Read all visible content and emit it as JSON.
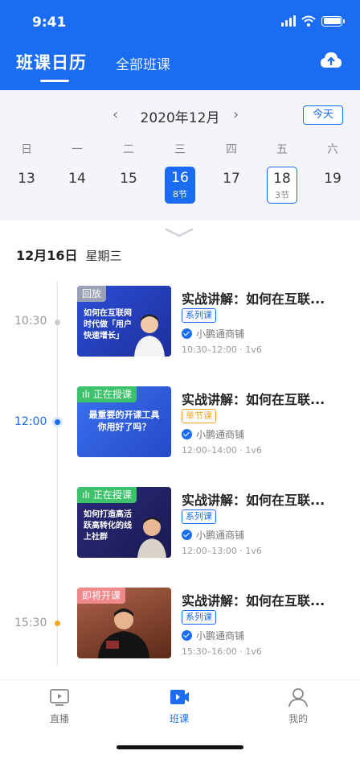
{
  "status_bar": {
    "time": "9:41"
  },
  "header": {
    "tab_active": "班课日历",
    "tab_inactive": "全部班课",
    "upload_icon": "cloud-upload-icon"
  },
  "calendar": {
    "month": "2020年12月",
    "today_label": "今天",
    "weekdays": [
      "日",
      "一",
      "二",
      "三",
      "四",
      "五",
      "六"
    ],
    "dates": [
      {
        "num": "13"
      },
      {
        "num": "14"
      },
      {
        "num": "15"
      },
      {
        "num": "16",
        "sub": "8节",
        "state": "selected"
      },
      {
        "num": "17"
      },
      {
        "num": "18",
        "sub": "3节",
        "state": "marked"
      },
      {
        "num": "19"
      }
    ]
  },
  "day": {
    "date": "12月16日",
    "weekday": "星期三"
  },
  "timeline": [
    {
      "time": "10:30",
      "dot_color": "#c8cbd0",
      "active": false
    },
    {
      "time": "12:00",
      "dot_color": "#1a6cf2",
      "active": true
    },
    {
      "time": "15:30",
      "dot_color": "#f5a623",
      "active": false
    }
  ],
  "courses": [
    {
      "badge": "回放",
      "badge_color": "#9aa3b5",
      "thumb_bg": "#2c4fd8",
      "thumb_text": "如何在互联网时代做「用户快速增长」",
      "title": "实战讲解：如何在互联...",
      "tag": "系列课",
      "tag_style": "blue",
      "teacher": "小鹏通商铺",
      "meta": "10:30–12:00 · 1v6"
    },
    {
      "badge": "正在授课",
      "badge_color": "#3cc26b",
      "thumb_bg": "#2f63e8",
      "thumb_text": "最重要的开课工具 你用好了吗？",
      "title": "实战讲解：如何在互联...",
      "tag": "单节课",
      "tag_style": "orange",
      "teacher": "小鹏通商铺",
      "meta": "12:00–14:00 · 1v6"
    },
    {
      "badge": "正在授课",
      "badge_color": "#3cc26b",
      "thumb_bg": "#2b2a7a",
      "thumb_text": "如何打造高活跃高转化的线上社群",
      "title": "实战讲解：如何在互联...",
      "tag": "系列课",
      "tag_style": "blue",
      "teacher": "小鹏通商铺",
      "meta": "12:00–13:00 · 1v6"
    },
    {
      "badge": "即将开课",
      "badge_color": "#f08a8a",
      "thumb_bg": "#7a3b22",
      "thumb_text": "",
      "title": "实战讲解：如何在互联...",
      "tag": "系列课",
      "tag_style": "blue",
      "teacher": "小鹏通商铺",
      "meta": "15:30–16:00 · 1v6"
    }
  ],
  "tabbar": [
    {
      "label": "直播",
      "icon": "live-tv-icon",
      "active": false
    },
    {
      "label": "班课",
      "icon": "class-video-icon",
      "active": true
    },
    {
      "label": "我的",
      "icon": "user-profile-icon",
      "active": false
    }
  ]
}
